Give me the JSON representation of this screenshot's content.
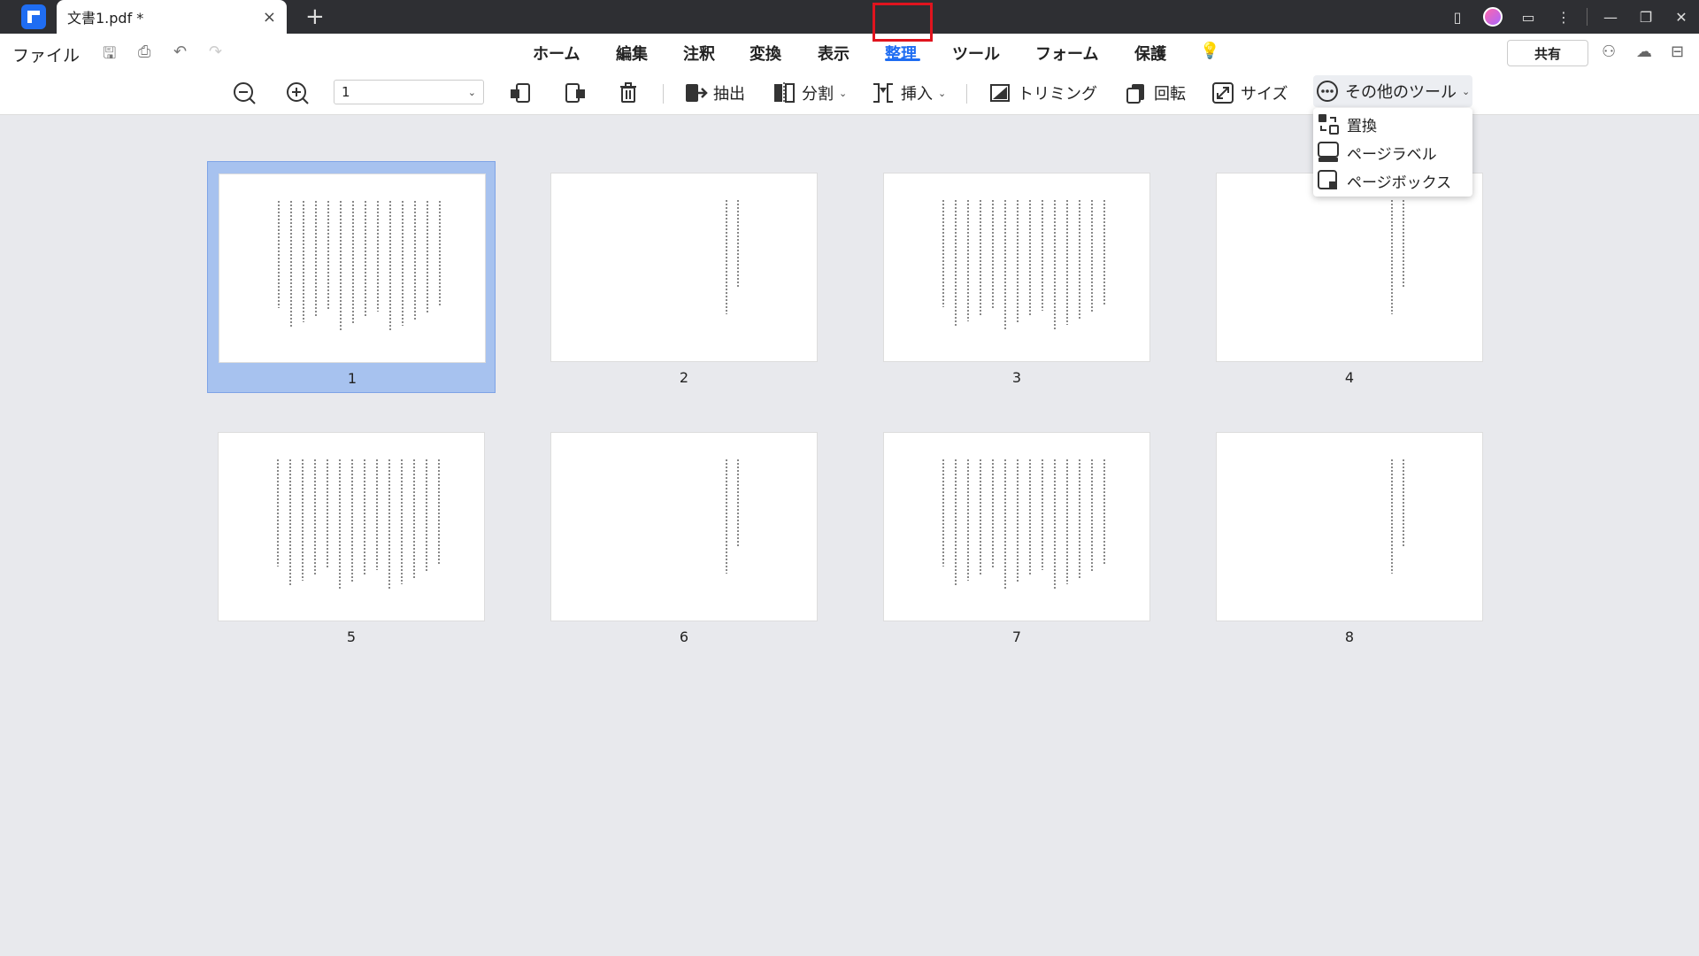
{
  "window": {
    "tab_title": "文書1.pdf *",
    "tab_close": "×",
    "new_tab": "+"
  },
  "menu": {
    "file": "ファイル",
    "tabs": [
      "ホーム",
      "編集",
      "注釈",
      "変換",
      "表示",
      "整理",
      "ツール",
      "フォーム",
      "保護"
    ],
    "active_tab": "整理",
    "share": "共有"
  },
  "toolbar": {
    "page_value": "1",
    "extract": "抽出",
    "split": "分割",
    "insert": "挿入",
    "crop": "トリミング",
    "rotate": "回転",
    "size": "サイズ",
    "more_tools": "その他のツール"
  },
  "dropdown": {
    "items": [
      "置換",
      "ページラベル",
      "ページボックス"
    ]
  },
  "pages": [
    {
      "label": "1",
      "selected": true,
      "density": "full"
    },
    {
      "label": "2",
      "selected": false,
      "density": "short"
    },
    {
      "label": "3",
      "selected": false,
      "density": "full"
    },
    {
      "label": "4",
      "selected": false,
      "density": "short"
    },
    {
      "label": "5",
      "selected": false,
      "density": "full"
    },
    {
      "label": "6",
      "selected": false,
      "density": "short"
    },
    {
      "label": "7",
      "selected": false,
      "density": "full"
    },
    {
      "label": "8",
      "selected": false,
      "density": "short"
    }
  ],
  "colors": {
    "accent": "#1f6df2",
    "highlight_box": "#e0141e",
    "selection": "#a7c2ef"
  }
}
